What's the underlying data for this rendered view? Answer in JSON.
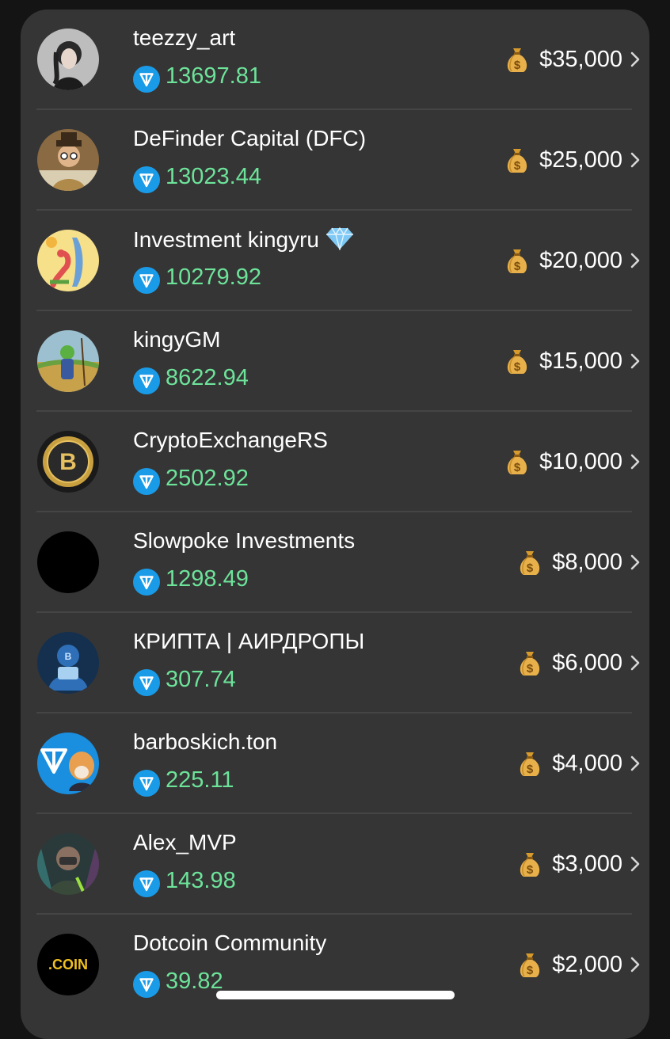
{
  "leaderboard": [
    {
      "name": "teezzy_art",
      "amount": "13697.81",
      "prize": "$35,000"
    },
    {
      "name": "DeFinder Capital (DFC)",
      "amount": "13023.44",
      "prize": "$25,000"
    },
    {
      "name": "Investment kingyru",
      "amount": "10279.92",
      "prize": "$20,000"
    },
    {
      "name": "kingyGM",
      "amount": "8622.94",
      "prize": "$15,000"
    },
    {
      "name": "CryptoExchangeRS",
      "amount": "2502.92",
      "prize": "$10,000"
    },
    {
      "name": "Slowpoke Investments",
      "amount": "1298.49",
      "prize": "$8,000"
    },
    {
      "name": "КРИПТА | АИРДРОПЫ",
      "amount": "307.74",
      "prize": "$6,000"
    },
    {
      "name": "barboskich.ton",
      "amount": "225.11",
      "prize": "$4,000"
    },
    {
      "name": "Alex_MVP",
      "amount": "143.98",
      "prize": "$3,000"
    },
    {
      "name": "Dotcoin Community",
      "amount": "39.82",
      "prize": "$2,000"
    }
  ],
  "avatar_texts": {
    "dotcoin": ".COIN"
  },
  "colors": {
    "amount": "#6de39a",
    "panel": "#353535",
    "ton": "#1a9be8"
  }
}
